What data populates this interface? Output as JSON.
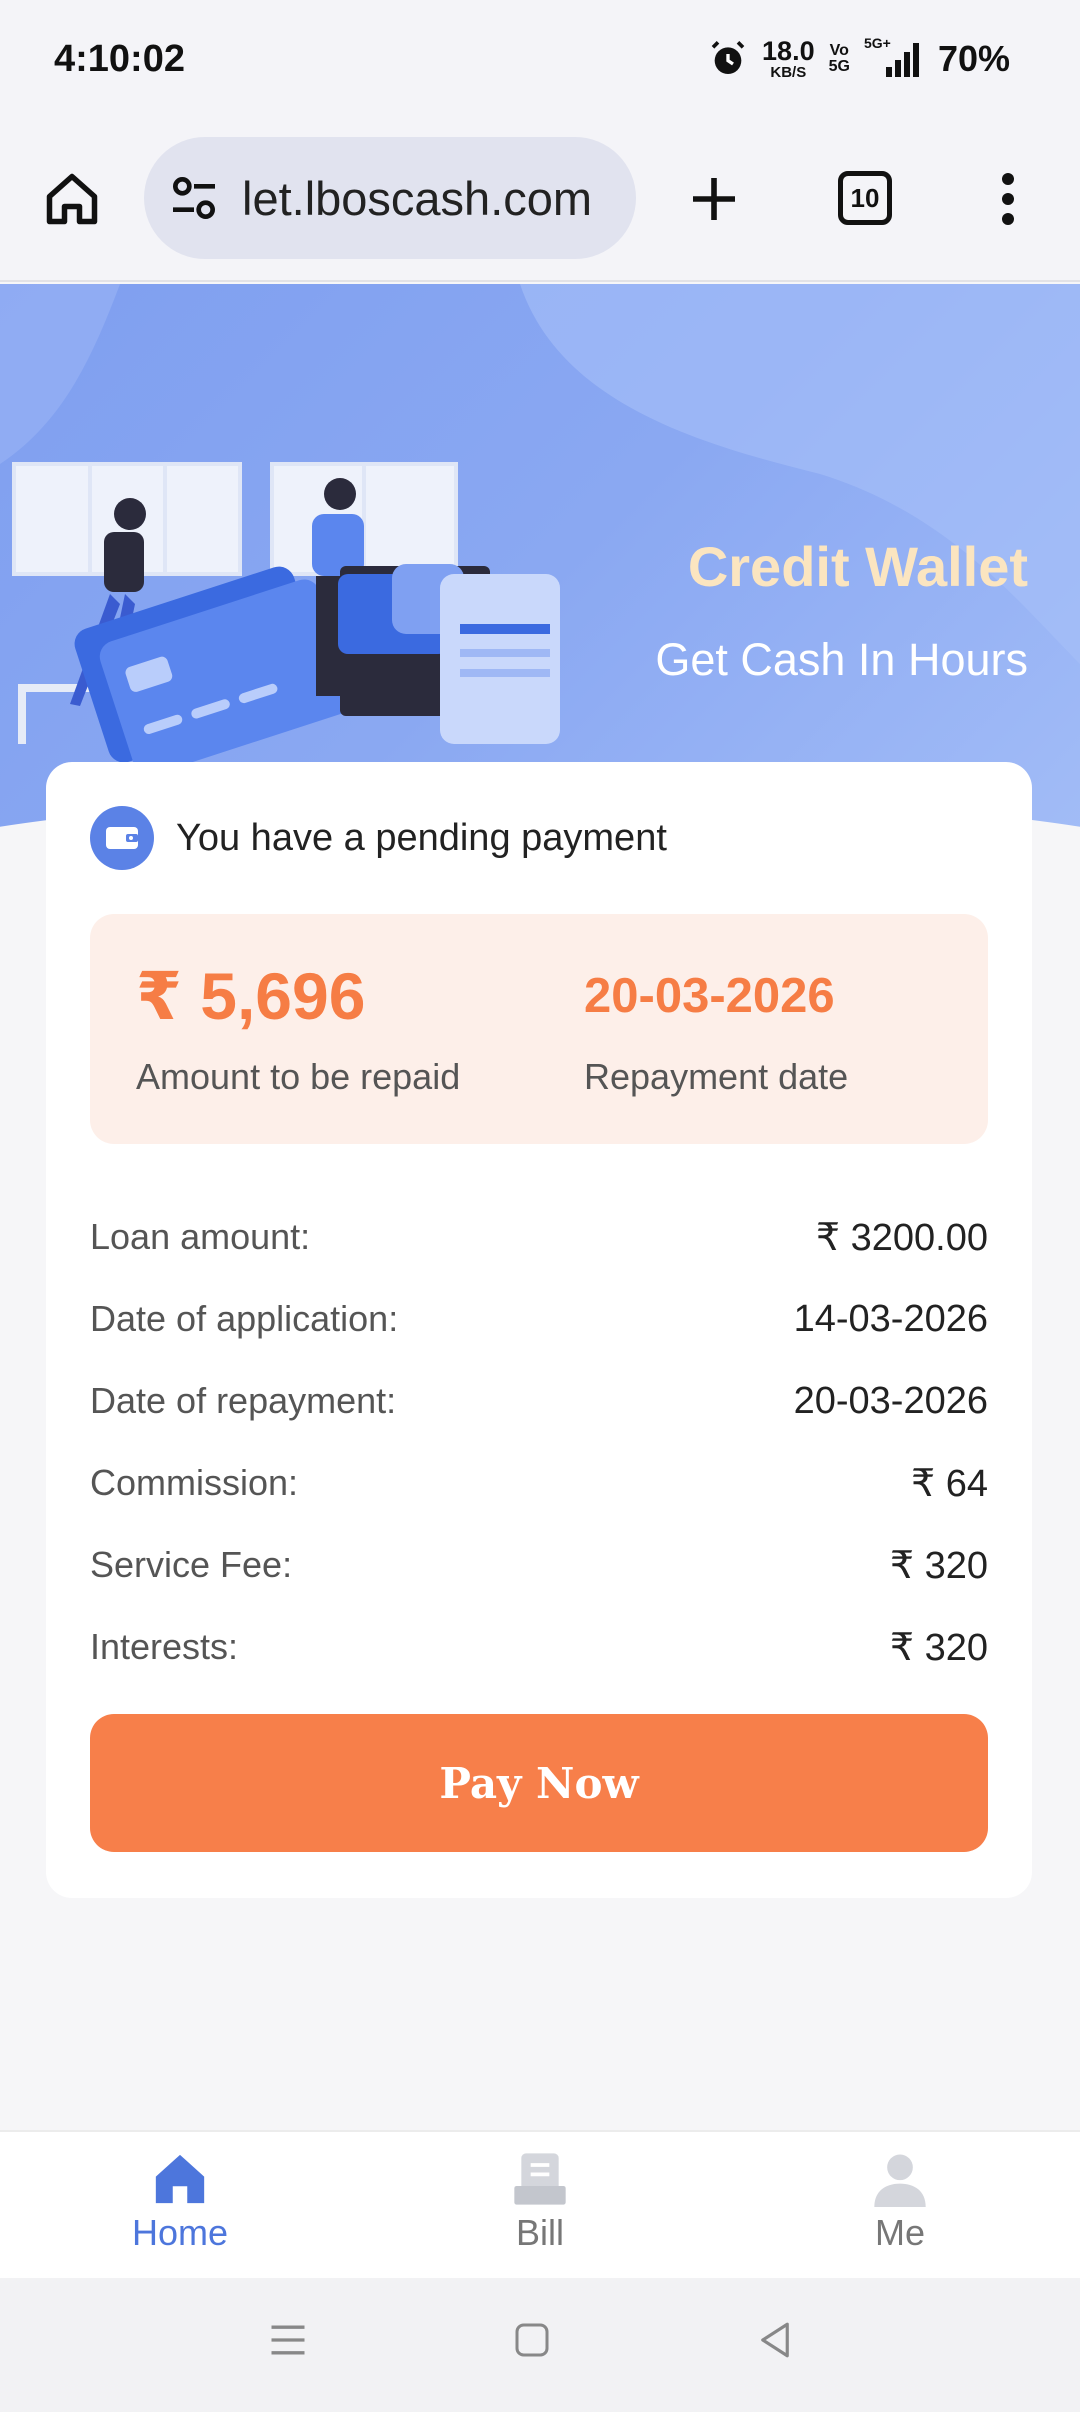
{
  "status_bar": {
    "time": "4:10:02",
    "net_speed": "18.0",
    "net_unit": "KB/S",
    "volte_top": "Vo",
    "volte_bottom": "5G",
    "signal_label": "5G+",
    "battery": "70%"
  },
  "browser": {
    "url": "let.lboscash.com",
    "tab_count": "10"
  },
  "hero": {
    "title": "Credit Wallet",
    "subtitle": "Get Cash In Hours"
  },
  "card": {
    "pending_text": "You have a pending payment",
    "amount": "₹ 5,696",
    "amount_label": "Amount to be repaid",
    "repayment_date": "20-03-2026",
    "repayment_date_label": "Repayment date",
    "details": [
      {
        "label": "Loan amount:",
        "value": "₹ 3200.00"
      },
      {
        "label": "Date of application:",
        "value": "14-03-2026"
      },
      {
        "label": "Date of repayment:",
        "value": "20-03-2026"
      },
      {
        "label": "Commission:",
        "value": "₹ 64"
      },
      {
        "label": "Service Fee:",
        "value": "₹ 320"
      },
      {
        "label": "Interests:",
        "value": "₹ 320"
      }
    ],
    "pay_button": "Pay Now"
  },
  "tabs": [
    {
      "label": "Home",
      "icon": "home-icon",
      "active": true
    },
    {
      "label": "Bill",
      "icon": "bill-icon",
      "active": false
    },
    {
      "label": "Me",
      "icon": "person-icon",
      "active": false
    }
  ],
  "colors": {
    "accent_orange": "#f77f4a",
    "accent_blue": "#4d76dc",
    "hero_title": "#fbe5c0",
    "repay_box_bg": "#fdefe9"
  }
}
